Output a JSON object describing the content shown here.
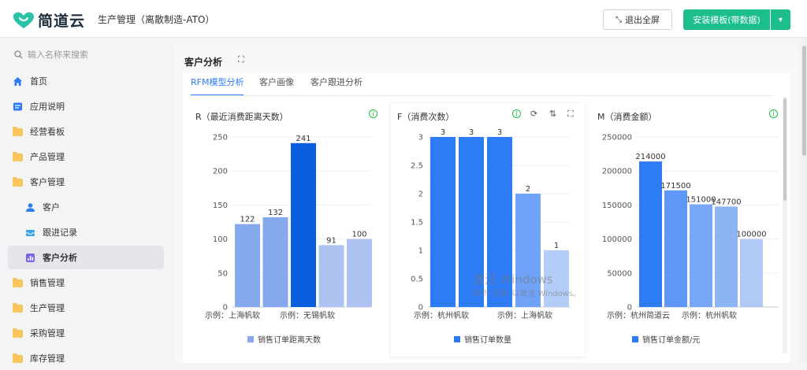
{
  "header": {
    "logo_text": "简道云",
    "app_title": "生产管理（离散制造-ATO）",
    "exit_fullscreen_label": "退出全屏",
    "install_label": "安装模板(带数据)"
  },
  "sidebar": {
    "search_placeholder": "输入名称来搜索",
    "items": [
      {
        "label": "首页",
        "icon": "home-icon"
      },
      {
        "label": "应用说明",
        "icon": "doc-icon"
      },
      {
        "label": "经营看板",
        "icon": "folder-icon"
      },
      {
        "label": "产品管理",
        "icon": "folder-icon"
      },
      {
        "label": "客户管理",
        "icon": "folder-icon"
      },
      {
        "label": "客户",
        "icon": "user-icon"
      },
      {
        "label": "跟进记录",
        "icon": "inbox-icon"
      },
      {
        "label": "客户分析",
        "icon": "chart-icon"
      },
      {
        "label": "销售管理",
        "icon": "folder-icon"
      },
      {
        "label": "生产管理",
        "icon": "folder-icon"
      },
      {
        "label": "采购管理",
        "icon": "folder-icon"
      },
      {
        "label": "库存管理",
        "icon": "folder-icon"
      }
    ]
  },
  "main": {
    "title": "客户分析",
    "tabs": [
      {
        "label": "RFM模型分析",
        "active": true
      },
      {
        "label": "客户画像",
        "active": false
      },
      {
        "label": "客户跟进分析",
        "active": false
      }
    ]
  },
  "colors": {
    "accent": "#2e7bf6",
    "brand": "#1cbe8c",
    "highlight_bar": "#0a5fe0"
  },
  "chart_data": [
    {
      "type": "bar",
      "title": "R（最近消费距离天数）",
      "x_tick_labels": [
        "示例：上海帆软",
        "示例：无锡帆软"
      ],
      "values": [
        122,
        132,
        241,
        91,
        100
      ],
      "value_labels": [
        "122",
        "132",
        "241",
        "91",
        "100"
      ],
      "bar_colors": [
        "#86a9ee",
        "#86a9ee",
        "#0a5fe0",
        "#afc3f3",
        "#afc3f3"
      ],
      "yticks": [
        0,
        50,
        100,
        150,
        200,
        250
      ],
      "ylim": [
        0,
        250
      ],
      "legend": "销售订单距离天数",
      "legend_color": "#86a9ee",
      "grid": true
    },
    {
      "type": "bar",
      "title": "F（消费次数）",
      "x_tick_labels": [
        "示例：杭州帆软",
        "示例：上海帆软"
      ],
      "values": [
        3,
        3,
        3,
        2,
        1
      ],
      "value_labels": [
        "3",
        "3",
        "3",
        "2",
        "1"
      ],
      "bar_colors": [
        "#2e7bf6",
        "#2e7bf6",
        "#2e7bf6",
        "#70a2f7",
        "#b4cdf8"
      ],
      "yticks": [
        0,
        0.5,
        1,
        1.5,
        2,
        2.5,
        3
      ],
      "ytick_labels": [
        "0",
        "0.5",
        "1",
        "1.5",
        "2",
        "2.5",
        "3"
      ],
      "ylim": [
        0,
        3
      ],
      "legend": "销售订单数量",
      "legend_color": "#2e7bf6",
      "grid": true
    },
    {
      "type": "bar",
      "title": "M（消费金额）",
      "x_tick_labels": [
        "示例：杭州简道云",
        "示例：杭州帆软"
      ],
      "values": [
        214000,
        171500,
        151000,
        147700,
        100000
      ],
      "value_labels": [
        "214000",
        "171500",
        "151000",
        "147700",
        "100000"
      ],
      "bar_colors": [
        "#2e7bf6",
        "#5e97f6",
        "#77a7f6",
        "#8db5f6",
        "#b0c9f5"
      ],
      "yticks": [
        0,
        50000,
        100000,
        150000,
        200000,
        250000
      ],
      "ylim": [
        0,
        250000
      ],
      "legend": "销售订单金额/元",
      "legend_color": "#2e7bf6",
      "grid": true
    }
  ],
  "watermark": {
    "line1": "激活 Windows",
    "line2": "转到\"设置\"以激活 Windows。"
  }
}
